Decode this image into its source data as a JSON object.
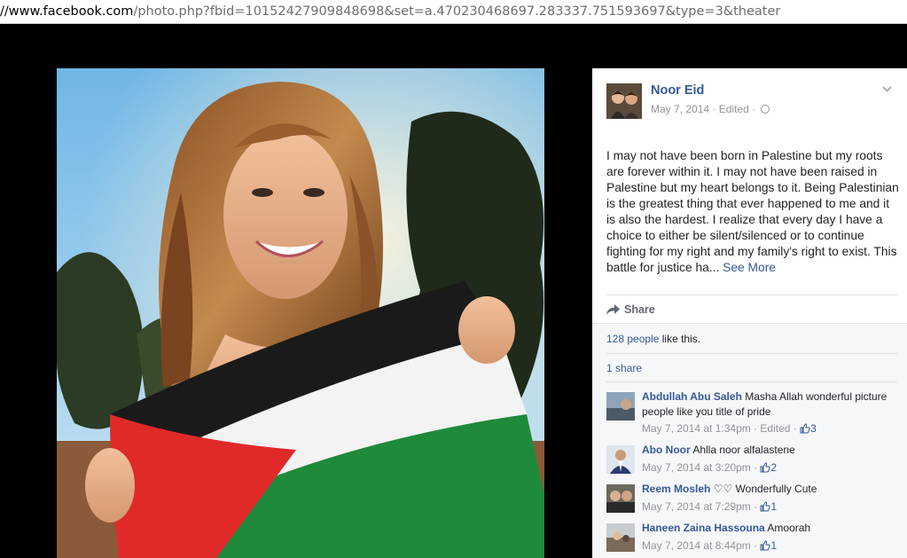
{
  "browser": {
    "url_host": "//www.facebook.com",
    "url_rest": "/photo.php?fbid=10152427909848698&set=a.470230468697.283337.751593697&type=3&theater"
  },
  "post": {
    "owner_name": "Noor Eid",
    "date": "May 7, 2014",
    "edited": "Edited",
    "caption": "I may not have been born in Palestine but my roots are forever within it. I may not have been raised in Palestine but my heart belongs to it. Being Palestinian is the greatest thing that ever happened to me and it is also the hardest. I realize that every day I have a choice to either be silent/silenced or to continue fighting for my right and my family's right to exist. This battle for justice ha...",
    "see_more": "See More",
    "share_label": "Share"
  },
  "engagement": {
    "likes_link": "128 people",
    "likes_suffix": "like this.",
    "shares": "1 share"
  },
  "comments": [
    {
      "author": "Abdullah Abu Saleh",
      "text": "Masha Allah wonderful picture people like you title of pride",
      "time": "May 7, 2014 at 1:34pm",
      "edited": "Edited",
      "likes": "3"
    },
    {
      "author": "Abo Noor",
      "text": "Ahlla noor alfalastene",
      "time": "May 7, 2014 at 3:20pm",
      "likes": "2"
    },
    {
      "author": "Reem Mosleh",
      "text": "♡♡ Wonderfully Cute",
      "time": "May 7, 2014 at 7:29pm",
      "likes": "1"
    },
    {
      "author": "Haneen Zaina Hassouna",
      "text": "Amoorah",
      "time": "May 7, 2014 at 8:44pm",
      "likes": "1"
    }
  ],
  "colors": {
    "link": "#365899",
    "meta": "#90949c",
    "flag_red": "#e02a2a",
    "flag_green": "#1f8a3a"
  },
  "icons": [
    "globe-icon",
    "chevron-down-icon",
    "share-arrow-icon",
    "thumbs-up-icon"
  ]
}
